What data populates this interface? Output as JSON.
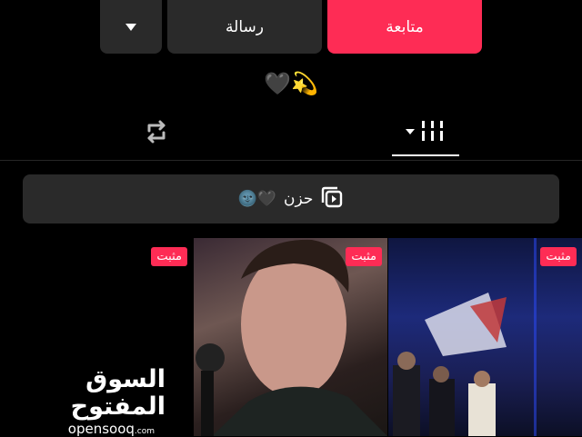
{
  "profile_actions": {
    "follow_label": "متابعة",
    "message_label": "رسالة",
    "dropdown_icon": "caret-down-icon"
  },
  "bio": {
    "text": "🖤💫"
  },
  "tabs": [
    {
      "name": "videos",
      "icon": "grid-sort-icon"
    },
    {
      "name": "reposts",
      "icon": "repost-icon"
    }
  ],
  "playlist": {
    "title": "حزن",
    "emoji": "🖤🌚",
    "icon": "playlist-icon"
  },
  "videos": [
    {
      "badge": "مثبت"
    },
    {
      "badge": "مثبت"
    },
    {
      "badge": "مثبت"
    }
  ],
  "watermark": {
    "arabic": "السوق المفتوح",
    "latin": "opensooq",
    "domain": ".com"
  },
  "colors": {
    "accent": "#fe2c55",
    "panel": "#2a2a2a",
    "background": "#000000"
  }
}
